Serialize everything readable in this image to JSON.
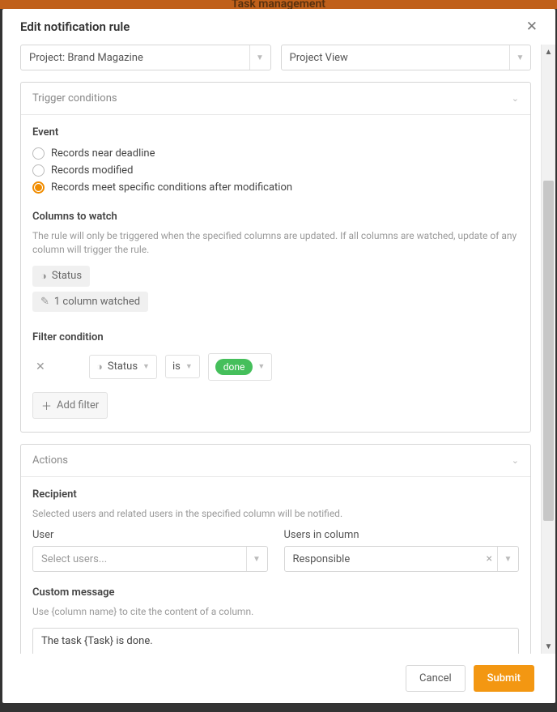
{
  "background_title": "Task management",
  "modal": {
    "title": "Edit notification rule",
    "project_select": "Project: Brand Magazine",
    "view_select": "Project View",
    "trigger": {
      "header": "Trigger conditions",
      "event_label": "Event",
      "radios": [
        "Records near deadline",
        "Records modified",
        "Records meet specific conditions after modification"
      ],
      "columns_label": "Columns to watch",
      "columns_hint": "The rule will only be triggered when the specified columns are updated. If all columns are watched, update of any column will trigger the rule.",
      "chip_status": "Status",
      "chip_watched": "1 column watched",
      "filter_label": "Filter condition",
      "filter_col": "Status",
      "filter_op": "is",
      "filter_val": "done",
      "add_filter": "Add filter"
    },
    "actions": {
      "header": "Actions",
      "recipient_label": "Recipient",
      "recipient_hint": "Selected users and related users in the specified column will be notified.",
      "user_label": "User",
      "user_placeholder": "Select users...",
      "col_label": "Users in column",
      "col_value": "Responsible",
      "msg_label": "Custom message",
      "msg_hint": "Use {column name} to cite the content of a column.",
      "msg_value": "The task {Task} is done."
    },
    "footer": {
      "cancel": "Cancel",
      "submit": "Submit"
    }
  }
}
